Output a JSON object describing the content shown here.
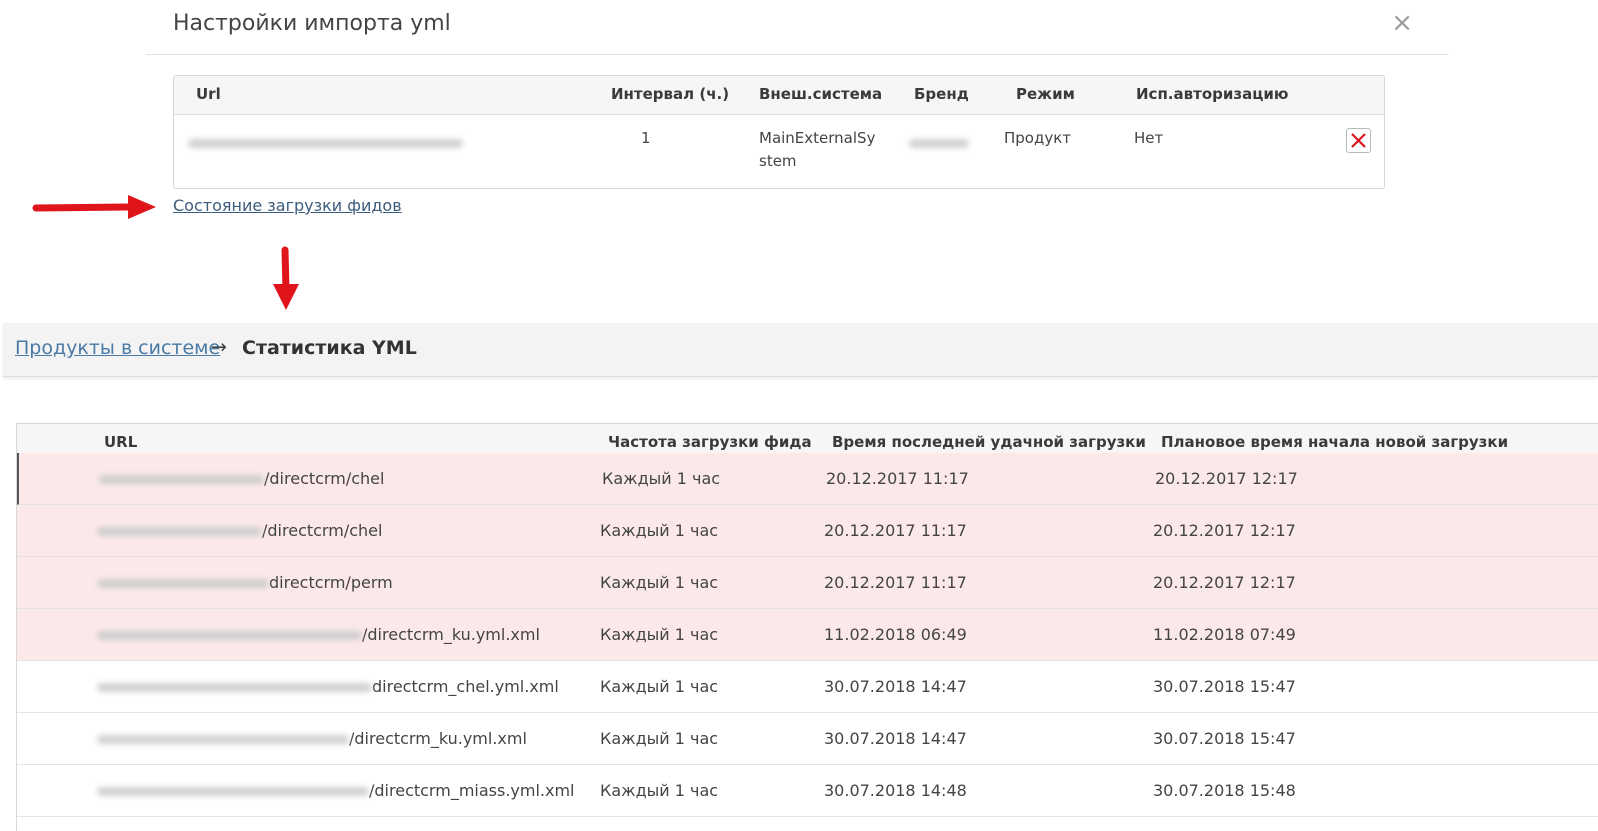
{
  "modal": {
    "title": "Настройки импорта yml",
    "close_label": "×",
    "columns": [
      "Url",
      "Интервал (ч.)",
      "Внеш.система",
      "Бренд",
      "Режим",
      "Исп.авторизацию"
    ],
    "row": {
      "interval": "1",
      "external_system_line1": "MainExternalSy",
      "external_system_line2": "stem",
      "mode": "Продукт",
      "use_auth": "Нет"
    },
    "feeds_link": "Состояние загрузки фидов"
  },
  "breadcrumb": {
    "parent": "Продукты в системе",
    "separator": "→",
    "current": "Статистика YML"
  },
  "stats": {
    "columns": [
      "URL",
      "Частота загрузки фида",
      "Время последней удачной загрузки",
      "Плановое время начала новой загрузки"
    ],
    "rows": [
      {
        "url_suffix": "/directcrm/chel",
        "frequency": "Каждый 1 час",
        "last_success": "20.12.2017 11:17",
        "next_planned": "20.12.2017 12:17"
      },
      {
        "url_suffix": "/directcrm/chel",
        "frequency": "Каждый 1 час",
        "last_success": "20.12.2017 11:17",
        "next_planned": "20.12.2017 12:17"
      },
      {
        "url_suffix": "directcrm/perm",
        "frequency": "Каждый 1 час",
        "last_success": "20.12.2017 11:17",
        "next_planned": "20.12.2017 12:17"
      },
      {
        "url_suffix": "/directcrm_ku.yml.xml",
        "frequency": "Каждый 1 час",
        "last_success": "11.02.2018 06:49",
        "next_planned": "11.02.2018 07:49"
      },
      {
        "url_suffix": "directcrm_chel.yml.xml",
        "frequency": "Каждый 1 час",
        "last_success": "30.07.2018 14:47",
        "next_planned": "30.07.2018 15:47"
      },
      {
        "url_suffix": "/directcrm_ku.yml.xml",
        "frequency": "Каждый 1 час",
        "last_success": "30.07.2018 14:47",
        "next_planned": "30.07.2018 15:47"
      },
      {
        "url_suffix": "/directcrm_miass.yml.xml",
        "frequency": "Каждый 1 час",
        "last_success": "30.07.2018 14:48",
        "next_planned": "30.07.2018 15:48"
      }
    ]
  },
  "colors": {
    "error_row": "#fbe9ea",
    "annotation_arrow": "#e0141b",
    "link": "#4a7aa6"
  },
  "icons": {
    "close": "close-icon",
    "delete": "delete-x-icon",
    "arrow_right": "red-arrow-right-icon",
    "arrow_down": "red-arrow-down-icon"
  }
}
